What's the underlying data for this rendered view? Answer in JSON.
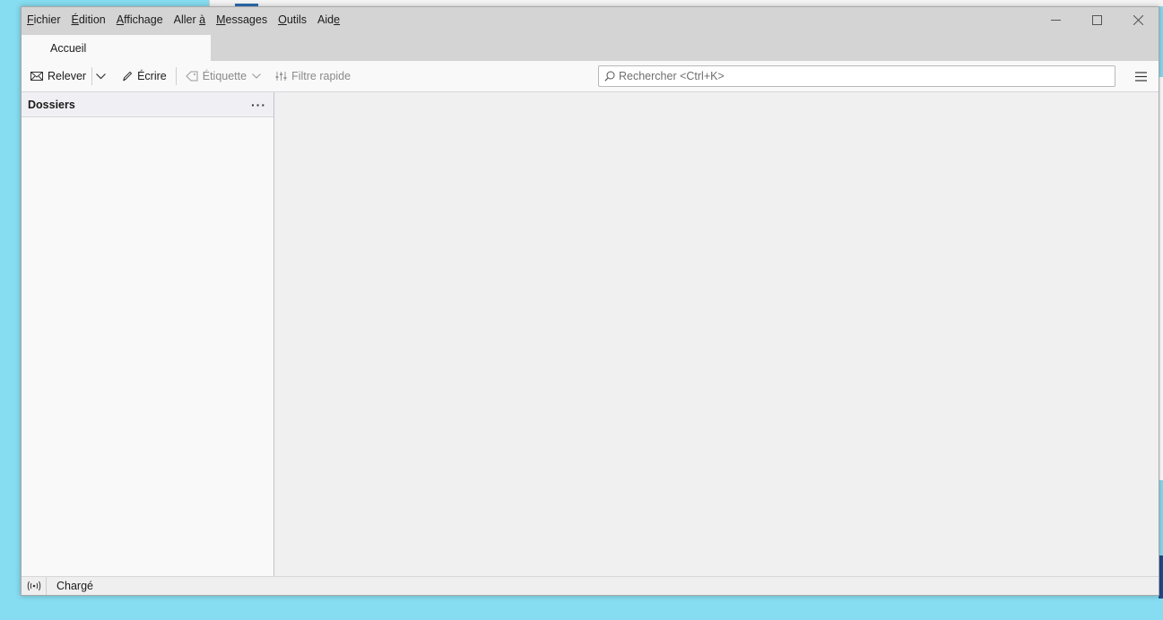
{
  "menubar": {
    "items": [
      {
        "before": "",
        "mnemonic": "F",
        "after": "ichier"
      },
      {
        "before": "",
        "mnemonic": "É",
        "after": "dition"
      },
      {
        "before": "",
        "mnemonic": "A",
        "after": "ffichage"
      },
      {
        "before": "Aller ",
        "mnemonic": "à",
        "after": ""
      },
      {
        "before": "",
        "mnemonic": "M",
        "after": "essages"
      },
      {
        "before": "",
        "mnemonic": "O",
        "after": "utils"
      },
      {
        "before": "Aid",
        "mnemonic": "e",
        "after": ""
      }
    ]
  },
  "tab": {
    "label": "Accueil"
  },
  "toolbar": {
    "get_messages_label": "Relever",
    "write_label": "Écrire",
    "tag_label": "Étiquette",
    "quick_filter_label": "Filtre rapide"
  },
  "search": {
    "placeholder": "Rechercher <Ctrl+K>",
    "value": ""
  },
  "folder_pane": {
    "title": "Dossiers",
    "more": "···"
  },
  "statusbar": {
    "text": "Chargé"
  },
  "colors": {
    "titlebar": "#d4d4d4",
    "desktop": "#86dcf0",
    "toolbar": "#f9f9fa"
  }
}
